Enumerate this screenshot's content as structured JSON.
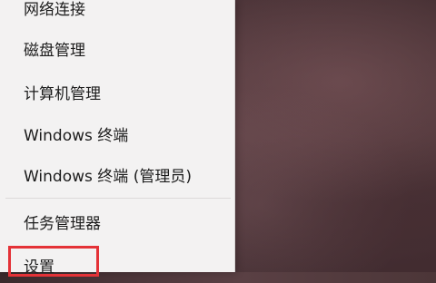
{
  "context_menu": {
    "items": [
      {
        "label": "网络连接"
      },
      {
        "label": "磁盘管理"
      },
      {
        "label": "计算机管理"
      },
      {
        "label": "Windows 终端"
      },
      {
        "label": "Windows 终端 (管理员)"
      },
      {
        "label": "任务管理器"
      },
      {
        "label": "设置"
      }
    ]
  },
  "colors": {
    "menu_background": "#f3f2f2",
    "text": "#1c1c1c",
    "highlight_border": "#e43237"
  }
}
